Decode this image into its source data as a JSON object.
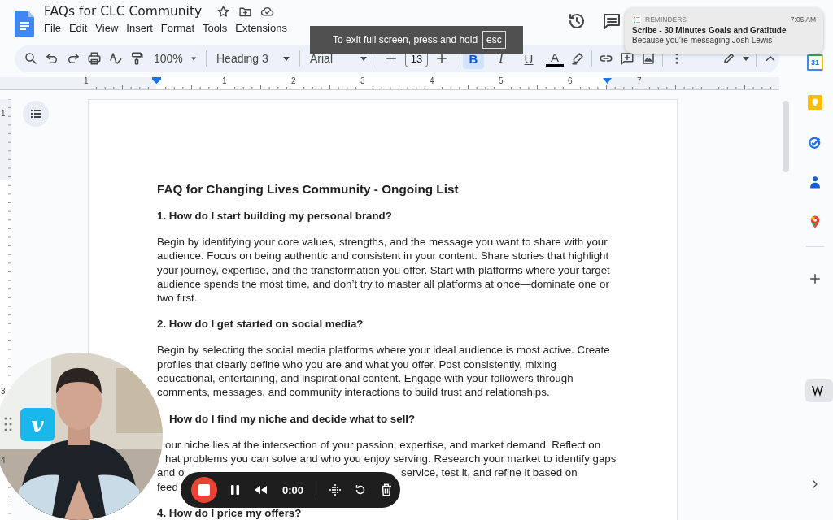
{
  "doc": {
    "title": "FAQs for CLC Community",
    "menu": [
      "File",
      "Edit",
      "View",
      "Insert",
      "Format",
      "Tools",
      "Extensions"
    ]
  },
  "toolbar": {
    "zoom": "100%",
    "style": "Heading 3",
    "font": "Arial",
    "font_size": "13",
    "format": [
      {
        "label": "B",
        "selected": true
      },
      {
        "label": "I",
        "selected": false
      },
      {
        "label": "U",
        "selected": false
      },
      {
        "label": "A",
        "selected": false
      }
    ]
  },
  "ruler": {
    "h_numbers": [
      "1",
      "1",
      "2",
      "3",
      "4",
      "5",
      "6",
      "7"
    ],
    "v_numbers": [
      "1",
      "3",
      "4"
    ]
  },
  "document": {
    "title": "FAQ for Changing Lives Community - Ongoing List",
    "blocks": [
      {
        "kind": "heading",
        "text": "1. How do I start building my personal brand?"
      },
      {
        "kind": "paragraph",
        "text": "Begin by identifying your core values, strengths, and the message you want to share with your audience. Focus on being authentic and consistent in your content. Share stories that highlight your journey, expertise, and the transformation you offer. Start with platforms where your target audience spends the most time, and don’t try to master all platforms at once—dominate one or two first."
      },
      {
        "kind": "heading",
        "text": "2. How do I get started on social media?"
      },
      {
        "kind": "paragraph",
        "text": "Begin by selecting the social media platforms where your ideal audience is most active. Create profiles that clearly define who you are and what you offer. Post consistently, mixing educational, entertaining, and inspirational content. Engage with your followers through comments, messages, and community interactions to build trust and relationships."
      },
      {
        "kind": "heading",
        "text": "How do I find my niche and decide what to sell?",
        "cut": true
      },
      {
        "kind": "lines",
        "lines": [
          {
            "parts": [
              "our niche lies at the intersection of your passion, expertise, and market demand. Reflect on"
            ],
            "cut": true
          },
          {
            "parts": [
              "hat problems you can solve and who you enjoy serving. Research your market to identify gaps"
            ],
            "cut": true
          },
          {
            "parts": [
              "and o",
              "service, test it, and refine it based on"
            ]
          },
          {
            "parts": [
              "feed"
            ]
          }
        ]
      },
      {
        "kind": "heading",
        "text": "4. How do I price my offers?"
      }
    ]
  },
  "toast": {
    "text": "To exit full screen, press and hold",
    "key": "esc"
  },
  "notification": {
    "app": "REMINDERS",
    "time": "7:05 AM",
    "title": "Scribe - 30 Minutes Goals and Gratitude",
    "body": "Because you’re messaging Josh Lewis"
  },
  "webcam": {
    "kind": "picture",
    "badge": "v"
  },
  "recorder": {
    "time": "0:00"
  },
  "sidebar": {
    "calendar_day": "31"
  }
}
